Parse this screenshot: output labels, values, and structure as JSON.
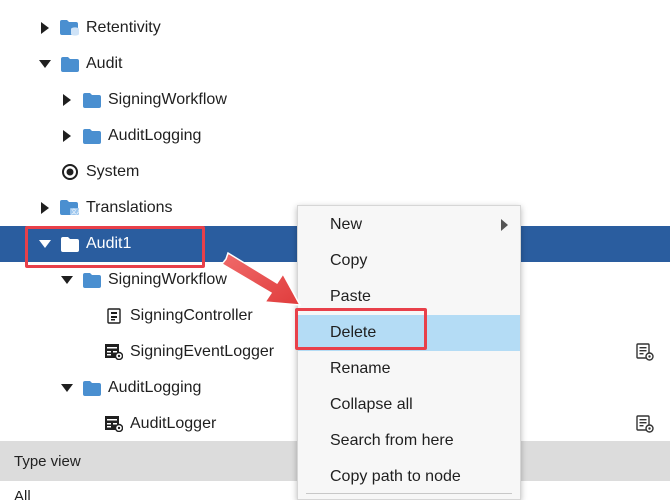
{
  "tree": [
    {
      "label": "Retentivity",
      "icon": "folder-database-icon",
      "expander": "collapsed",
      "indent": 0
    },
    {
      "label": "Audit",
      "icon": "folder-icon",
      "expander": "expanded",
      "indent": 0
    },
    {
      "label": "SigningWorkflow",
      "icon": "folder-icon",
      "expander": "collapsed",
      "indent": 1
    },
    {
      "label": "AuditLogging",
      "icon": "folder-icon",
      "expander": "collapsed",
      "indent": 1
    },
    {
      "label": "System",
      "icon": "system-icon",
      "expander": "none",
      "indent": 0
    },
    {
      "label": "Translations",
      "icon": "folder-translations-icon",
      "expander": "collapsed",
      "indent": 0
    },
    {
      "label": "Audit1",
      "icon": "folder-icon",
      "expander": "expanded",
      "indent": 0,
      "selected": true
    },
    {
      "label": "SigningWorkflow",
      "icon": "folder-icon",
      "expander": "expanded",
      "indent": 1
    },
    {
      "label": "SigningController",
      "icon": "controller-icon",
      "expander": "none",
      "indent": 2
    },
    {
      "label": "SigningEventLogger",
      "icon": "logger-grid-icon",
      "expander": "none",
      "indent": 2,
      "side_icon": "properties-icon"
    },
    {
      "label": "AuditLogging",
      "icon": "folder-icon",
      "expander": "expanded",
      "indent": 1
    },
    {
      "label": "AuditLogger",
      "icon": "logger-grid-icon",
      "expander": "none",
      "indent": 2,
      "side_icon": "properties-icon"
    }
  ],
  "type_view": {
    "label": "Type view"
  },
  "below_text": "All",
  "context_menu": {
    "items": [
      {
        "label": "New",
        "submenu": true
      },
      {
        "label": "Copy"
      },
      {
        "label": "Paste"
      },
      {
        "label": "Delete",
        "hovered": true
      },
      {
        "label": "Rename"
      },
      {
        "label": "Collapse all"
      },
      {
        "label": "Search from here"
      },
      {
        "label": "Copy path to node"
      }
    ]
  },
  "colors": {
    "selection": "#2a5d9f",
    "folder": "#4a8fd0",
    "highlight": "#e8404a",
    "menu_hover": "#b4dcf5",
    "type_view_bg": "#dcdcdc"
  }
}
